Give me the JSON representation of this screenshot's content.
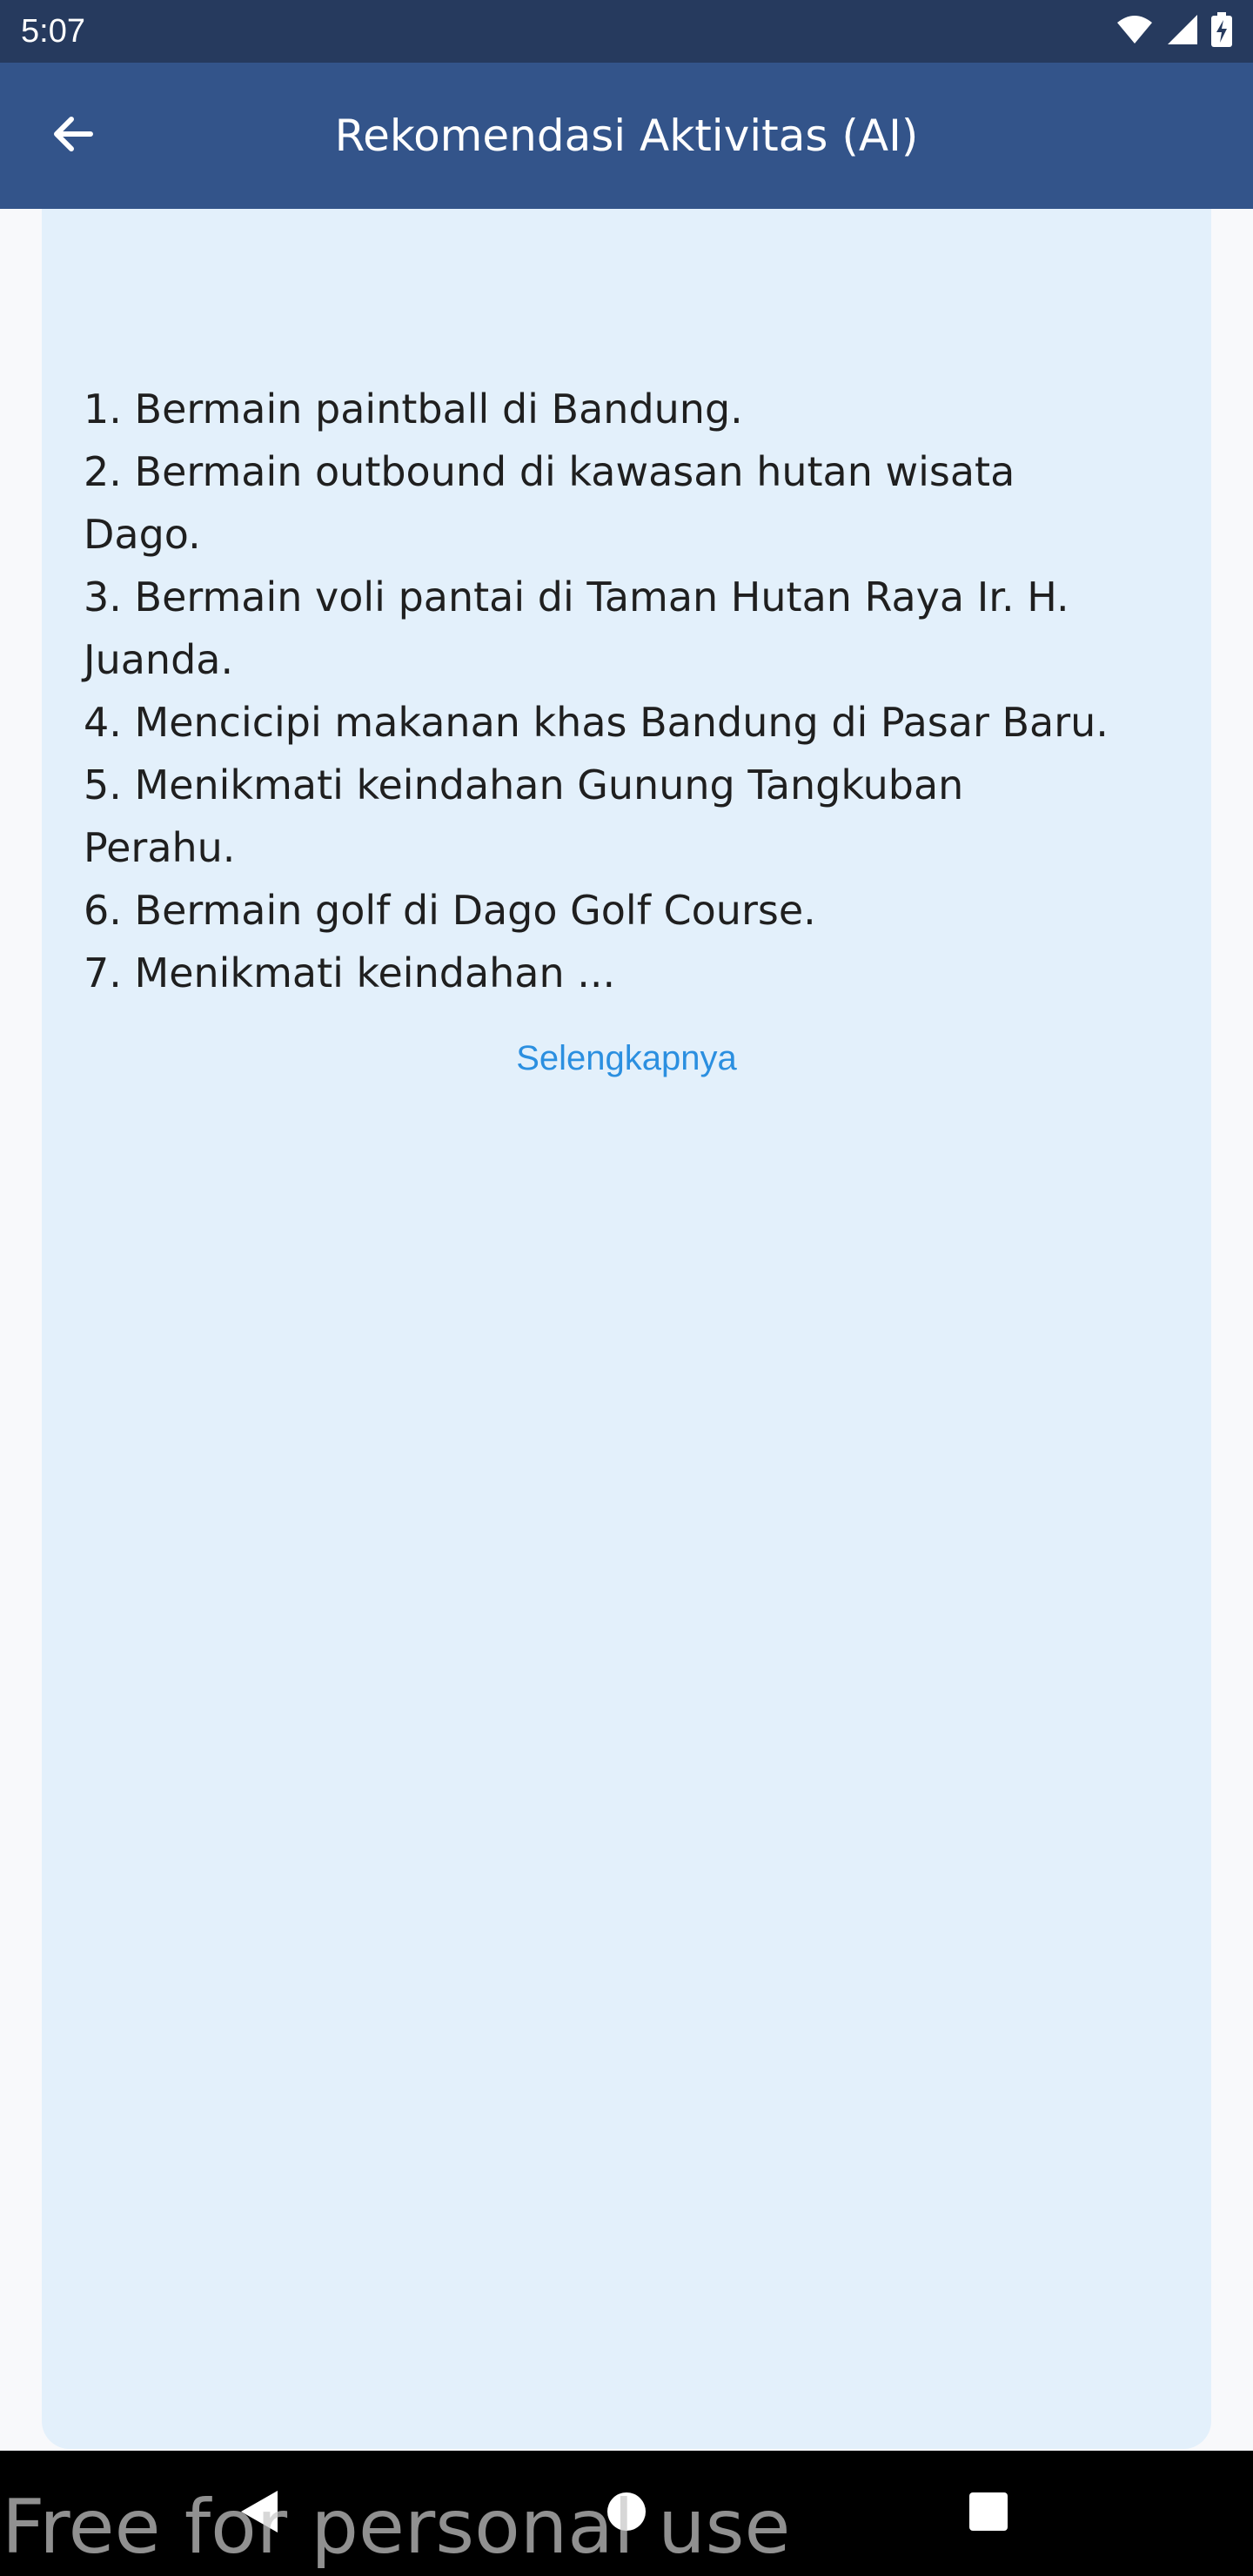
{
  "status_bar": {
    "time": "5:07",
    "icons": [
      "wifi-icon",
      "cellular-signal-icon",
      "battery-charging-icon"
    ]
  },
  "app_bar": {
    "title": "Rekomendasi Aktivitas (AI)",
    "back_icon": "arrow-left-icon",
    "background_color": "#33548a"
  },
  "card": {
    "background_color": "#e3f0fb",
    "lines": [
      "1. Bermain paintball di Bandung.",
      "2. Bermain outbound di kawasan hutan wisata",
      "Dago.",
      "3. Bermain voli pantai di Taman Hutan Raya Ir. H.",
      "Juanda.",
      "4. Mencicipi makanan khas Bandung di Pasar Baru.",
      "5. Menikmati keindahan Gunung Tangkuban",
      "Perahu.",
      "6. Bermain golf di Dago Golf Course.",
      "7. Menikmati keindahan ..."
    ],
    "more_label": "Selengkapnya",
    "link_color": "#2b8fe0"
  },
  "nav_bar": {
    "icons": [
      "nav-back-icon",
      "nav-home-icon",
      "nav-recents-icon"
    ]
  },
  "watermark": "Free for personal use"
}
